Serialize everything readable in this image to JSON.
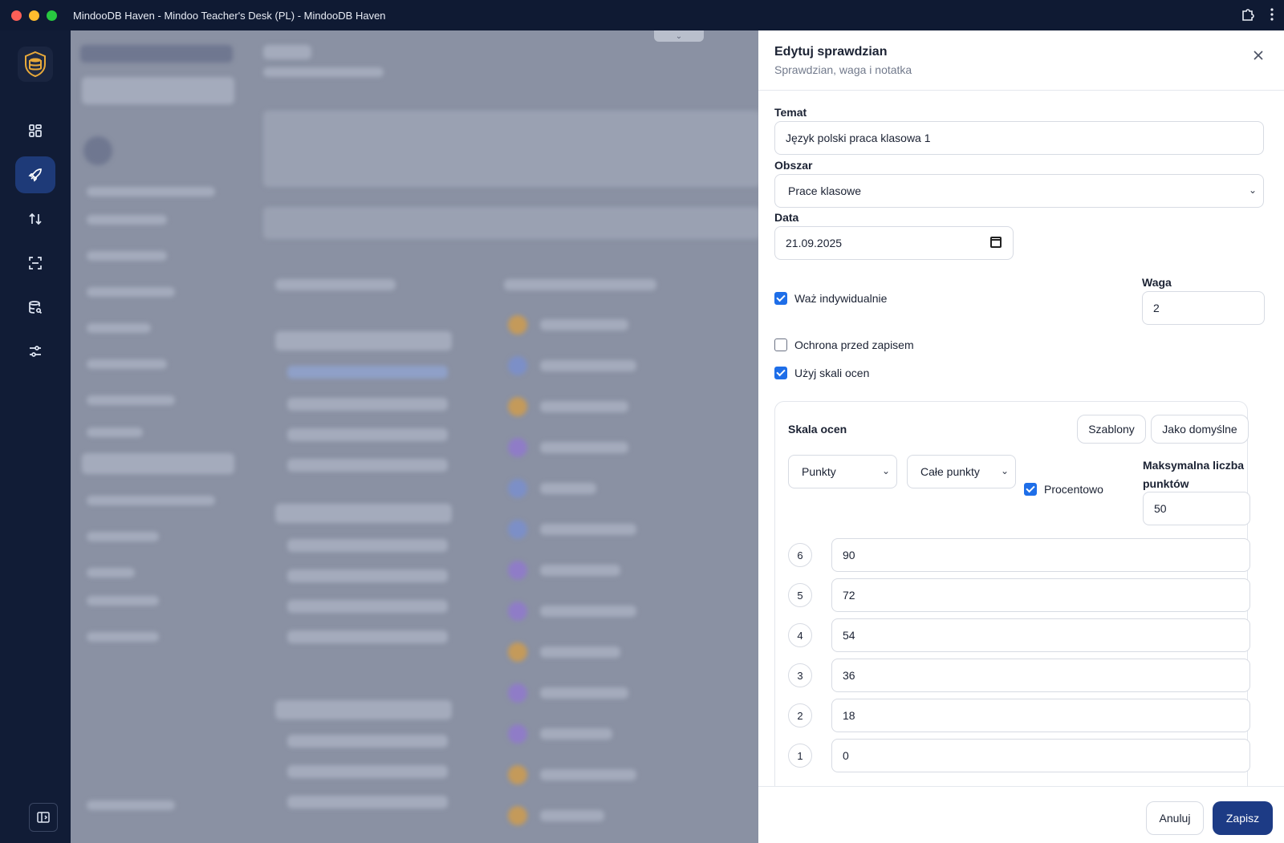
{
  "window": {
    "title": "MindooDB Haven - Mindoo Teacher's Desk (PL) - MindooDB Haven"
  },
  "rail": {
    "items": [
      "dashboard-icon",
      "rocket-icon",
      "sort-arrows-icon",
      "scan-icon",
      "database-search-icon",
      "sliders-icon"
    ],
    "active_index": 1
  },
  "drawer": {
    "title": "Edytuj sprawdzian",
    "subtitle": "Sprawdzian, waga i notatka",
    "topic_label": "Temat",
    "topic_value": "Język polski praca klasowa 1",
    "area_label": "Obszar",
    "area_value": "Prace klasowe",
    "date_label": "Data",
    "date_value": "21.09.2025",
    "weight_individual_label": "Waż indywidualnie",
    "weight_individual_checked": true,
    "weight_label": "Waga",
    "weight_value": "2",
    "protect_label": "Ochrona przed zapisem",
    "protect_checked": false,
    "use_scale_label": "Użyj skali ocen",
    "use_scale_checked": true
  },
  "scale": {
    "title": "Skala ocen",
    "templates_button": "Szablony",
    "default_button": "Jako domyślne",
    "mode_value": "Punkty",
    "points_value": "Całe punkty",
    "percent_label": "Procentowo",
    "percent_checked": true,
    "max_points_label": "Maksymalna liczba punktów",
    "max_points_value": "50",
    "grades": [
      {
        "grade": "6",
        "threshold": "90"
      },
      {
        "grade": "5",
        "threshold": "72"
      },
      {
        "grade": "4",
        "threshold": "54"
      },
      {
        "grade": "3",
        "threshold": "36"
      },
      {
        "grade": "2",
        "threshold": "18"
      },
      {
        "grade": "1",
        "threshold": "0"
      }
    ]
  },
  "footer": {
    "cancel_label": "Anuluj",
    "save_label": "Zapisz"
  },
  "colors": {
    "primary": "#1d3b85",
    "checkbox": "#1e6ee8",
    "rail_active": "#1e3a78"
  }
}
